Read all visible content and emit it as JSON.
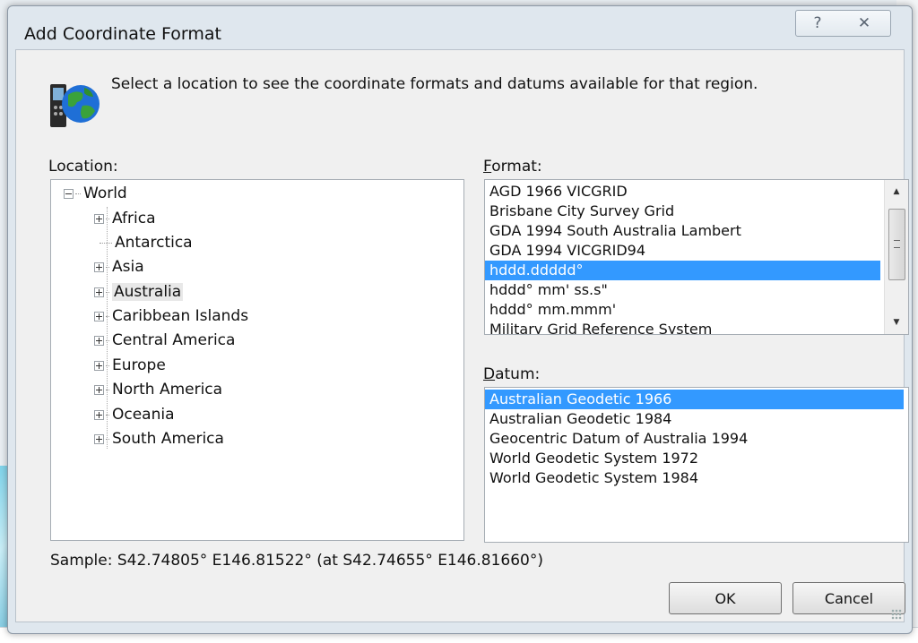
{
  "dialog": {
    "title": "Add Coordinate Format",
    "help_glyph": "?",
    "close_glyph": "✕",
    "instruction": "Select a location to see the coordinate formats and datums available for that region."
  },
  "location": {
    "label_u": "L",
    "label_rest": "ocation:",
    "root": "World",
    "items": [
      {
        "label": "Africa",
        "expandable": true
      },
      {
        "label": "Antarctica",
        "expandable": false
      },
      {
        "label": "Asia",
        "expandable": true
      },
      {
        "label": "Australia",
        "expandable": true,
        "selected": true
      },
      {
        "label": "Caribbean Islands",
        "expandable": true
      },
      {
        "label": "Central America",
        "expandable": true
      },
      {
        "label": "Europe",
        "expandable": true
      },
      {
        "label": "North America",
        "expandable": true
      },
      {
        "label": "Oceania",
        "expandable": true
      },
      {
        "label": "South America",
        "expandable": true
      }
    ]
  },
  "format": {
    "label_u": "F",
    "label_rest": "ormat:",
    "items": [
      "AGD 1966 VICGRID",
      "Brisbane City Survey Grid",
      "GDA 1994 South Australia Lambert",
      "GDA 1994 VICGRID94",
      "hddd.ddddd°",
      "hddd° mm' ss.s\"",
      "hddd° mm.mmm'",
      "Military Grid Reference System"
    ],
    "selected_index": 4
  },
  "datum": {
    "label_u": "D",
    "label_rest": "atum:",
    "items": [
      "Australian Geodetic 1966",
      "Australian Geodetic 1984",
      "Geocentric Datum of Australia 1994",
      "World Geodetic System 1972",
      "World Geodetic System 1984"
    ],
    "selected_index": 0
  },
  "sample": "Sample: S42.74805° E146.81522° (at S42.74655° E146.81660°)",
  "buttons": {
    "ok": "OK",
    "cancel": "Cancel"
  },
  "colors": {
    "selection": "#3399ff"
  },
  "icons": {
    "dialog_icon": "globe-device-icon"
  }
}
